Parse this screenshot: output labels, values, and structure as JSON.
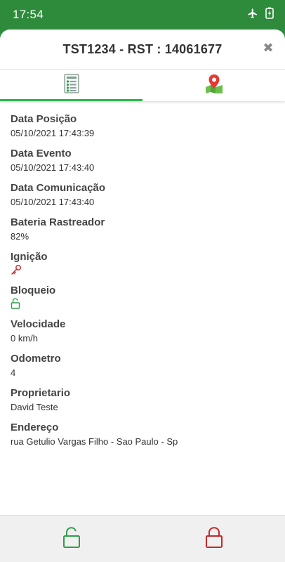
{
  "status_bar": {
    "time": "17:54",
    "icons": [
      "airplane-icon",
      "battery-charging-icon"
    ]
  },
  "header": {
    "title": "TST1234 - RST : 14061677",
    "close_icon": "close-icon"
  },
  "tabs": [
    {
      "icon": "checklist-icon",
      "active": true
    },
    {
      "icon": "map-pin-icon",
      "active": false
    }
  ],
  "details": {
    "data_posicao": {
      "label": "Data Posição",
      "value": "05/10/2021 17:43:39"
    },
    "data_evento": {
      "label": "Data Evento",
      "value": "05/10/2021 17:43:40"
    },
    "data_comunicacao": {
      "label": "Data Comunicação",
      "value": "05/10/2021 17:43:40"
    },
    "bateria": {
      "label": "Bateria Rastreador",
      "value": "82%"
    },
    "ignicao": {
      "label": "Ignição",
      "icon": "key-icon",
      "color": "#c62828"
    },
    "bloqueio": {
      "label": "Bloqueio",
      "icon": "unlocked-icon",
      "color": "#2e9e4a"
    },
    "velocidade": {
      "label": "Velocidade",
      "value": "0 km/h"
    },
    "odometro": {
      "label": "Odometro",
      "value": "4"
    },
    "proprietario": {
      "label": "Proprietario",
      "value": "David Teste"
    },
    "endereco": {
      "label": "Endereço",
      "value": "rua Getulio Vargas Filho - Sao Paulo - Sp"
    }
  },
  "bottom_bar": {
    "unlock_button": {
      "icon": "unlock-icon",
      "color": "#2e9e4a"
    },
    "lock_button": {
      "icon": "lock-icon",
      "color": "#c62828"
    }
  },
  "colors": {
    "brand_green": "#2e8b3b",
    "tab_indicator": "#2db84d"
  }
}
